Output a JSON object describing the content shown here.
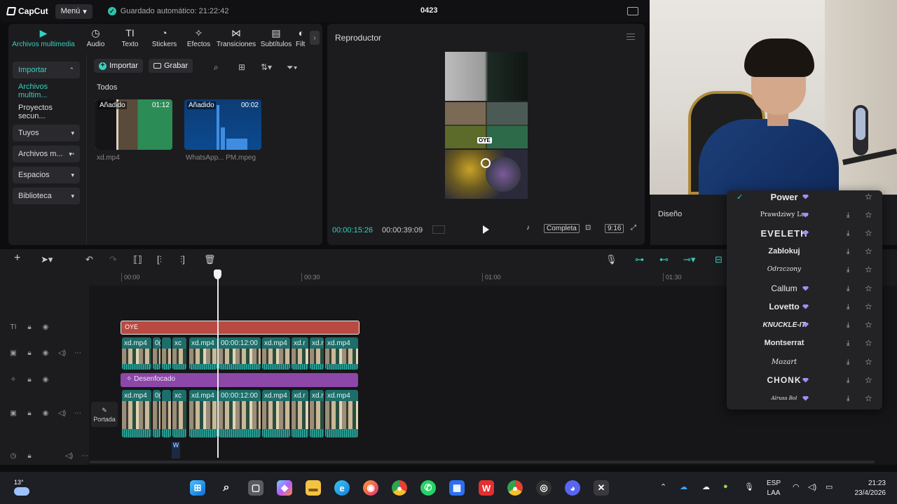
{
  "titlebar": {
    "app": "CapCut",
    "menu_label": "Menú",
    "autosave": "Guardado automático: 21:22:42",
    "project": "0423"
  },
  "tabs": [
    {
      "label": "Archivos multimedia",
      "icon": "media-icon"
    },
    {
      "label": "Audio",
      "icon": "audio-icon"
    },
    {
      "label": "Texto",
      "icon": "text-icon"
    },
    {
      "label": "Stickers",
      "icon": "sticker-icon"
    },
    {
      "label": "Efectos",
      "icon": "effects-icon"
    },
    {
      "label": "Transiciones",
      "icon": "transitions-icon"
    },
    {
      "label": "Subtítulos",
      "icon": "subtitles-icon"
    },
    {
      "label": "Filt",
      "icon": "filters-icon"
    }
  ],
  "sidebar": {
    "importar": "Importar",
    "archivos": "Archivos multim...",
    "proyectos": "Proyectos secun...",
    "tuyos": "Tuyos",
    "archivos_m": "Archivos m...",
    "espacios": "Espacios",
    "biblioteca": "Biblioteca"
  },
  "media": {
    "import_btn": "Importar",
    "record_btn": "Grabar",
    "section": "Todos",
    "items": [
      {
        "tag": "Añadido",
        "duration": "01:12",
        "name": "xd.mp4"
      },
      {
        "tag": "Añadido",
        "duration": "00:02",
        "name": "WhatsApp... PM.mpeg"
      }
    ]
  },
  "player": {
    "title": "Reproductor",
    "current": "00:00:15:26",
    "total": "00:00:39:09",
    "full_label": "Completa",
    "ratio": "9:16",
    "overlay_text": "OYE"
  },
  "right_panel": {
    "design_label": "Diseño"
  },
  "timeline": {
    "ruler": [
      "00:00",
      "00:30",
      "01:00",
      "01:30"
    ],
    "text_clip": "OYE",
    "effect_clip": "Desenfocado",
    "video_label": "xd.mp4",
    "video_label_short": "xd.r",
    "video_label_tiny": "xc",
    "video_label_mini": "0(",
    "video_timecode": "00:00:12:00",
    "cover_label": "Portada",
    "marker": "W"
  },
  "fonts": [
    {
      "name": "Power",
      "premium": true,
      "selected": true
    },
    {
      "name": "Prawdziwy Los",
      "premium": true
    },
    {
      "name": "EVELETH",
      "premium": true
    },
    {
      "name": "Zablokuj",
      "premium": false
    },
    {
      "name": "Odrzczony",
      "premium": false
    },
    {
      "name": "Callum",
      "premium": true
    },
    {
      "name": "Lovetto",
      "premium": true
    },
    {
      "name": "KNUCKLE-IT",
      "premium": true
    },
    {
      "name": "Montserrat",
      "premium": false
    },
    {
      "name": "Mozart",
      "premium": false
    },
    {
      "name": "CHONK",
      "premium": true
    },
    {
      "name": "Alrusa Bol",
      "premium": true
    }
  ],
  "taskbar": {
    "temperature": "13°",
    "lang_top": "ESP",
    "lang_bottom": "LAA",
    "time": "21:23",
    "date": "23/4/2026"
  },
  "colors": {
    "accent": "#34d1bf",
    "text_clip": "#b84a42",
    "effect_clip": "#8c47a8",
    "video_clip": "#1d6e6a",
    "premium_gem": "#a58cff"
  }
}
